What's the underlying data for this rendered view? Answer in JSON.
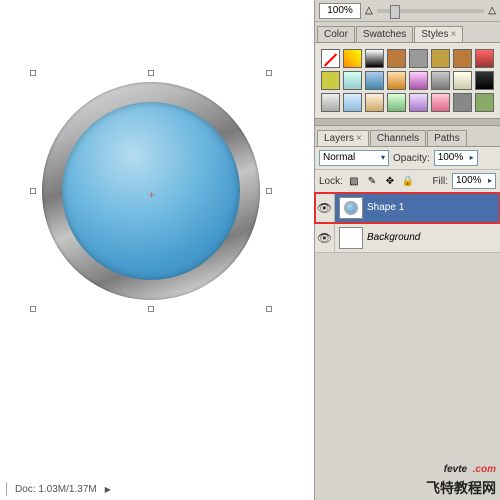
{
  "zoom": {
    "value": "100%"
  },
  "tabs_styles": {
    "color": "Color",
    "swatches": "Swatches",
    "styles": "Styles"
  },
  "swatches": [
    "none",
    "linear-gradient(45deg,#f80,#ff0)",
    "linear-gradient(#fff,#000)",
    "#b97a3a",
    "#999",
    "#c0a040",
    "#b97a3a",
    "linear-gradient(#f66,#933)",
    "#cc4",
    "linear-gradient(#cfe,#9cc)",
    "linear-gradient(#ace,#48a)",
    "linear-gradient(#fda,#c82)",
    "linear-gradient(#fcf,#a5a)",
    "linear-gradient(#ccc,#777)",
    "linear-gradient(#ffe,#cca)",
    "linear-gradient(#333,#000)",
    "linear-gradient(#eee,#aaa)",
    "linear-gradient(#def,#8bd)",
    "linear-gradient(#fed,#ca6)",
    "linear-gradient(#dfd,#7b7)",
    "linear-gradient(#edf,#a7c)",
    "linear-gradient(#fcd,#d68)",
    "#888",
    "#8a6"
  ],
  "tabs_layers": {
    "layers": "Layers",
    "channels": "Channels",
    "paths": "Paths"
  },
  "blend": {
    "mode": "Normal",
    "opacity_label": "Opacity:",
    "opacity": "100%"
  },
  "lock": {
    "label": "Lock:",
    "fill_label": "Fill:",
    "fill": "100%"
  },
  "layers": [
    {
      "name": "Shape 1",
      "selected": true
    },
    {
      "name": "Background",
      "selected": false
    }
  ],
  "doc": {
    "size": "Doc: 1.03M/1.37M"
  },
  "watermark": {
    "url": "fevte .com",
    "text": "飞特教程网"
  }
}
